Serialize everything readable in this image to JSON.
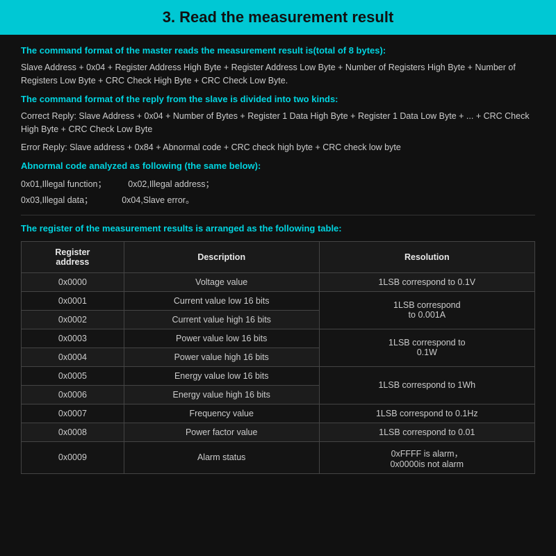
{
  "header": {
    "title": "3. Read the measurement result"
  },
  "sections": {
    "command_format_label": "The command format of the master reads the measurement result is(total of 8 bytes):",
    "command_format_body": "Slave Address + 0x04 + Register Address High Byte + Register Address Low Byte + Number of Registers High Byte + Number of Registers Low Byte + CRC Check High Byte + CRC Check Low Byte.",
    "reply_format_label": "The command format of the reply from the slave is divided into two kinds:",
    "correct_reply": "Correct Reply: Slave Address + 0x04 + Number of Bytes + Register 1 Data High Byte + Register 1 Data Low Byte + ... + CRC Check High Byte + CRC Check Low Byte",
    "error_reply": "Error Reply: Slave address + 0x84 + Abnormal code + CRC check high byte + CRC check low byte",
    "abnormal_label": "Abnormal code analyzed as following (the same below):",
    "abnormal_codes": [
      "0x01,Illegal function；",
      "0x02,Illegal address；",
      "0x03,Illegal data；",
      "0x04,Slave error。"
    ],
    "table_intro": "The register of the measurement results is arranged as the following table:"
  },
  "table": {
    "headers": [
      "Register address",
      "Description",
      "Resolution"
    ],
    "rows": [
      [
        "0x0000",
        "Voltage value",
        "1LSB correspond to 0.1V"
      ],
      [
        "0x0001",
        "Current value low 16 bits",
        "1LSB correspond\nto 0.001A"
      ],
      [
        "0x0002",
        "Current value high 16 bits",
        ""
      ],
      [
        "0x0003",
        "Power value low 16 bits",
        "1LSB correspond to\n0.1W"
      ],
      [
        "0x0004",
        "Power value high 16 bits",
        ""
      ],
      [
        "0x0005",
        "Energy value low 16 bits",
        "1LSB correspond to 1Wh"
      ],
      [
        "0x0006",
        "Energy value high 16 bits",
        ""
      ],
      [
        "0x0007",
        "Frequency value",
        "1LSB correspond to 0.1Hz"
      ],
      [
        "0x0008",
        "Power factor value",
        "1LSB correspond to 0.01"
      ],
      [
        "0x0009",
        "Alarm status",
        "0xFFFF is alarm，\n0x0000is not alarm"
      ]
    ]
  }
}
